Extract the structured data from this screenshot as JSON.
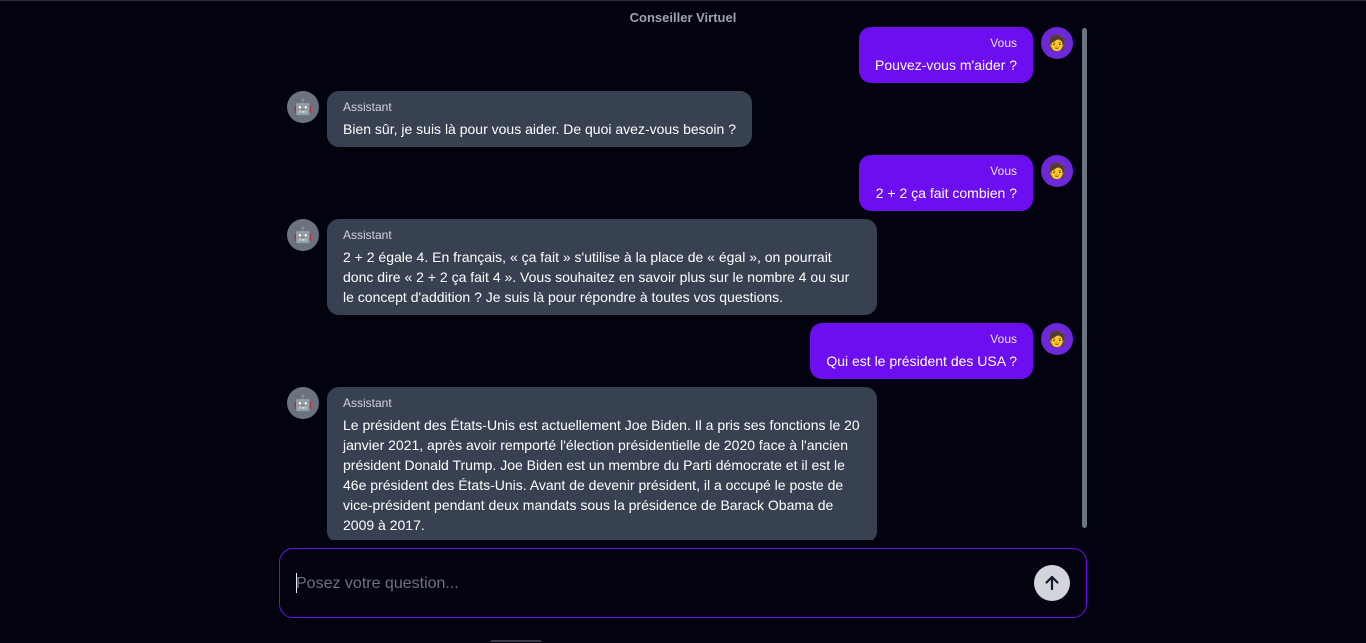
{
  "header": {
    "title": "Conseiller Virtuel"
  },
  "messages": [
    {
      "role": "user",
      "sender": "Vous",
      "avatar_icon": "user-emoji-icon",
      "avatar_glyph": "🧑",
      "text": "Pouvez-vous m'aider ?"
    },
    {
      "role": "assistant",
      "sender": "Assistant",
      "avatar_icon": "robot-emoji-icon",
      "avatar_glyph": "🤖",
      "text": "Bien sûr, je suis là pour vous aider. De quoi avez-vous besoin ?"
    },
    {
      "role": "user",
      "sender": "Vous",
      "avatar_icon": "user-emoji-icon",
      "avatar_glyph": "🧑",
      "text": "2 + 2 ça fait combien ?"
    },
    {
      "role": "assistant",
      "sender": "Assistant",
      "avatar_icon": "robot-emoji-icon",
      "avatar_glyph": "🤖",
      "text": "2 + 2 égale 4. En français, « ça fait » s'utilise à la place de « égal », on pourrait donc dire « 2 + 2 ça fait 4 ». Vous souhaitez en savoir plus sur le nombre 4 ou sur le concept d'addition ? Je suis là pour répondre à toutes vos questions."
    },
    {
      "role": "user",
      "sender": "Vous",
      "avatar_icon": "user-emoji-icon",
      "avatar_glyph": "🧑",
      "text": "Qui est le président des USA ?"
    },
    {
      "role": "assistant",
      "sender": "Assistant",
      "avatar_icon": "robot-emoji-icon",
      "avatar_glyph": "🤖",
      "text": "Le président des États-Unis est actuellement Joe Biden. Il a pris ses fonctions le 20 janvier 2021, après avoir remporté l'élection présidentielle de 2020 face à l'ancien président Donald Trump. Joe Biden est un membre du Parti démocrate et il est le 46e président des États-Unis. Avant de devenir président, il a occupé le poste de vice-président pendant deux mandats sous la présidence de Barack Obama de 2009 à 2017."
    }
  ],
  "composer": {
    "placeholder": "Posez votre question...",
    "value": "",
    "send_icon": "arrow-up-icon"
  },
  "colors": {
    "background": "#03030f",
    "user_bubble": "#6d0ef0",
    "assistant_bubble": "#374151",
    "accent_border": "#6d0ef0"
  }
}
